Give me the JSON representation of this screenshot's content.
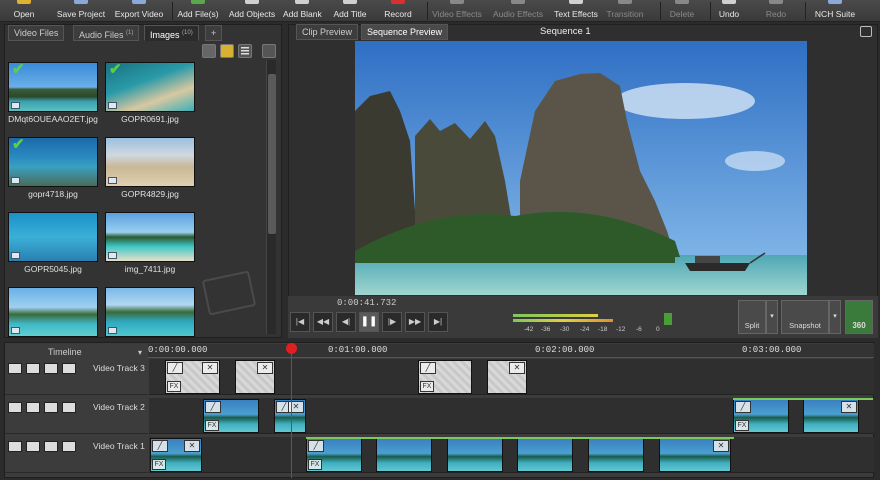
{
  "toolbar": {
    "items": [
      {
        "label": "Open",
        "dim": false
      },
      {
        "label": "Save Project",
        "dim": false
      },
      {
        "label": "Export Video",
        "dim": false
      },
      {
        "label": "Add File(s)",
        "dim": false
      },
      {
        "label": "Add Objects",
        "dim": false
      },
      {
        "label": "Add Blank",
        "dim": false
      },
      {
        "label": "Add Title",
        "dim": false
      },
      {
        "label": "Record",
        "dim": false
      },
      {
        "label": "Video Effects",
        "dim": true
      },
      {
        "label": "Audio Effects",
        "dim": true
      },
      {
        "label": "Text Effects",
        "dim": false
      },
      {
        "label": "Transition",
        "dim": true
      },
      {
        "label": "Delete",
        "dim": true
      },
      {
        "label": "Undo",
        "dim": false
      },
      {
        "label": "Redo",
        "dim": true
      },
      {
        "label": "NCH Suite",
        "dim": false
      }
    ]
  },
  "bin": {
    "tabs": [
      {
        "label": "Video Files",
        "count": ""
      },
      {
        "label": "Audio Files",
        "count": "(1)"
      },
      {
        "label": "Images",
        "count": "(10)"
      },
      {
        "label": "+",
        "count": ""
      }
    ],
    "items": [
      {
        "name": "DMqt6OUEAAO2ET.jpg",
        "checked": true,
        "scene": "rock"
      },
      {
        "name": "GOPR0691.jpg",
        "checked": true,
        "scene": "lagoon"
      },
      {
        "name": "gopr4718.jpg",
        "checked": true,
        "scene": "underwater"
      },
      {
        "name": "GOPR4829.jpg",
        "checked": false,
        "scene": "beach"
      },
      {
        "name": "GOPR5045.jpg",
        "checked": false,
        "scene": "reef"
      },
      {
        "name": "img_7411.jpg",
        "checked": false,
        "scene": "boat"
      },
      {
        "name": "",
        "checked": false,
        "scene": "island"
      },
      {
        "name": "",
        "checked": false,
        "scene": "swim"
      }
    ]
  },
  "preview": {
    "tabs": [
      "Clip Preview",
      "Sequence Preview"
    ],
    "title": "Sequence 1",
    "timecode": "0:00:41.732",
    "meter_labels": [
      "-42",
      "-36",
      "-30",
      "-24",
      "-18",
      "-12",
      "-6",
      "0"
    ],
    "tools": [
      "Split",
      "Snapshot",
      "360"
    ]
  },
  "timeline": {
    "label": "Timeline",
    "ruler": [
      "0:00:00.000",
      "0:01:00.000",
      "0:02:00.000",
      "0:03:00.000"
    ],
    "tracks": [
      {
        "name": "Video Track 3"
      },
      {
        "name": "Video Track 2"
      },
      {
        "name": "Video Track 1"
      }
    ],
    "fx_label": "FX"
  },
  "colors": {
    "accent_green": "#7cc85a",
    "playhead": "#e02020",
    "background": "#2b2b2b"
  }
}
